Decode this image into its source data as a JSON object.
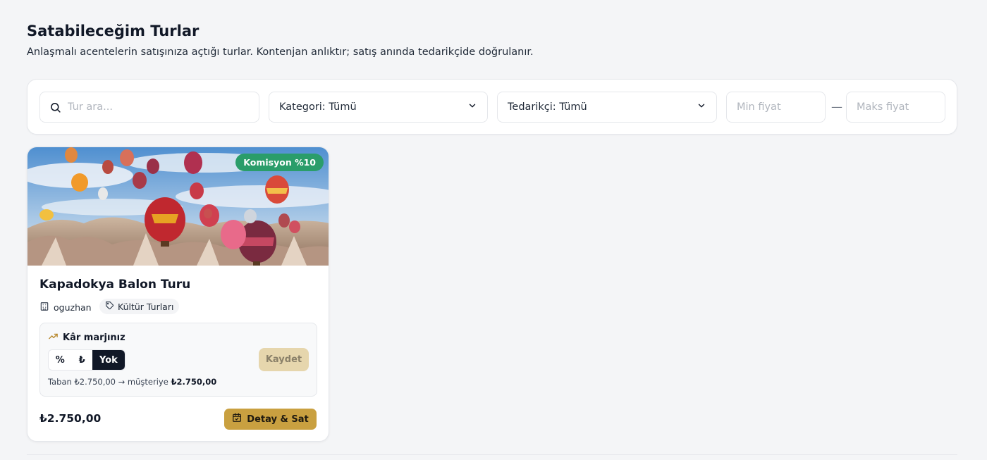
{
  "header": {
    "title": "Satabileceğim Turlar",
    "subtitle": "Anlaşmalı acentelerin satışınıza açtığı turlar. Kontenjan anlıktır; satış anında tedarikçide doğrulanır."
  },
  "filters": {
    "search_placeholder": "Tur ara...",
    "search_icon": "search-icon",
    "category_select": "Kategori: Tümü",
    "supplier_select": "Tedarikçi: Tümü",
    "chevron_icon": "chevron-down-icon",
    "min_price_placeholder": "Min fiyat",
    "separator": "—",
    "max_price_placeholder": "Maks fiyat"
  },
  "tours": [
    {
      "title": "Kapadokya Balon Turu",
      "commission_badge": "Komisyon %10",
      "supplier": "oguzhan",
      "supplier_icon": "building-icon",
      "category": "Kültür Turları",
      "category_icon": "tag-icon",
      "margin": {
        "heading": "Kâr marjınız",
        "heading_icon": "trending-up-icon",
        "options": [
          "%",
          "₺",
          "Yok"
        ],
        "selected": "Yok",
        "save_label": "Kaydet",
        "note_prefix": "Taban ₺2.750,00 → müşteriye",
        "note_value": "₺2.750,00"
      },
      "price": "₺2.750,00",
      "action_label": "Detay & Sat",
      "action_icon": "calendar-icon"
    }
  ],
  "colors": {
    "accent_gold": "#c9a040",
    "badge_green": "#2a9d6a",
    "selected_dark": "#111827"
  }
}
